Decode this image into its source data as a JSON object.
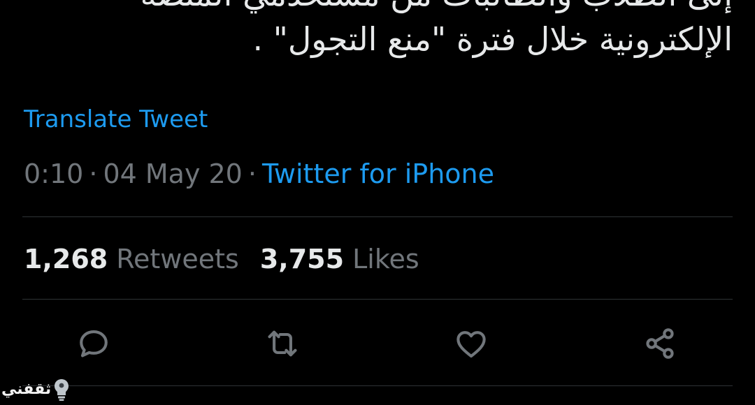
{
  "tweet": {
    "text_lines": [
      "إلى الطلاب والطالبات من مستخدمي المنصة",
      "الإلكترونية خلال فترة \"منع التجول\" ."
    ],
    "translate_label": "Translate Tweet",
    "time": "0:10",
    "separator": "·",
    "date": "04 May 20",
    "source": "Twitter for iPhone"
  },
  "stats": {
    "retweets_count": "1,268",
    "retweets_label": "Retweets",
    "likes_count": "3,755",
    "likes_label": "Likes"
  },
  "actions": [
    {
      "icon": "reply-icon"
    },
    {
      "icon": "retweet-icon"
    },
    {
      "icon": "like-icon"
    },
    {
      "icon": "share-icon"
    }
  ],
  "watermark": {
    "text": "ثقفني"
  },
  "colors": {
    "background": "#000000",
    "text_primary": "#e7e9ea",
    "text_secondary": "#71767b",
    "accent": "#1d9bf0",
    "divider": "#2f3336"
  }
}
